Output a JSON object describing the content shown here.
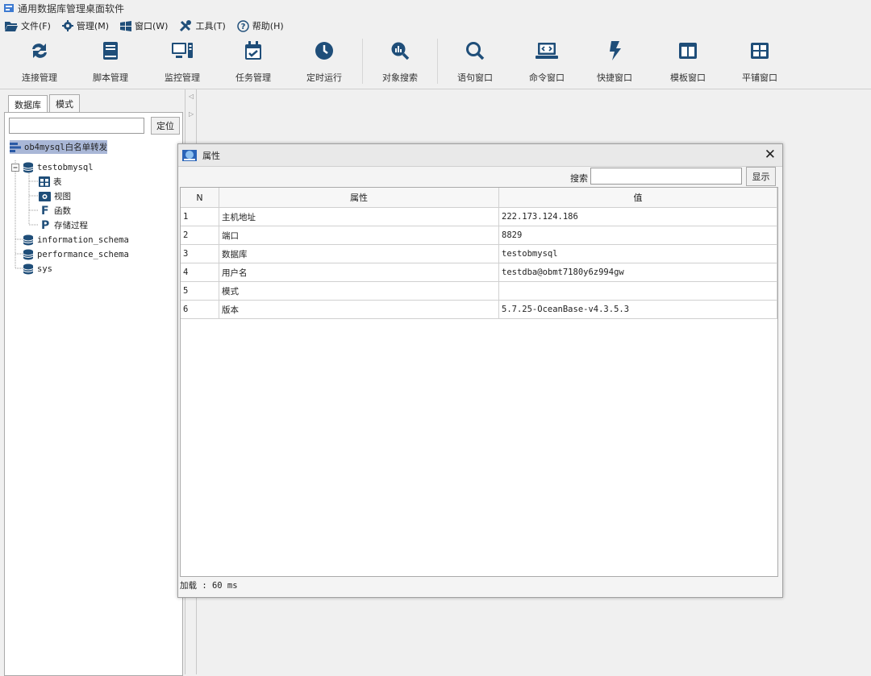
{
  "app": {
    "title": "通用数据库管理桌面软件"
  },
  "menu": [
    {
      "label": "文件(F)",
      "icon": "folder-open-icon"
    },
    {
      "label": "管理(M)",
      "icon": "gear-icon"
    },
    {
      "label": "窗口(W)",
      "icon": "windows-icon"
    },
    {
      "label": "工具(T)",
      "icon": "tools-icon"
    },
    {
      "label": "帮助(H)",
      "icon": "help-icon"
    }
  ],
  "toolbar": [
    {
      "label": "连接管理",
      "icon": "sync-arrows-icon"
    },
    {
      "label": "脚本管理",
      "icon": "book-icon"
    },
    {
      "label": "监控管理",
      "icon": "monitor-icon"
    },
    {
      "label": "任务管理",
      "icon": "calendar-check-icon"
    },
    {
      "label": "定时运行",
      "icon": "clock-icon"
    },
    {
      "label": "对象搜索",
      "icon": "search-chart-icon"
    },
    {
      "label": "语句窗口",
      "icon": "search-icon"
    },
    {
      "label": "命令窗口",
      "icon": "laptop-code-icon"
    },
    {
      "label": "快捷窗口",
      "icon": "bolt-icon"
    },
    {
      "label": "模板窗口",
      "icon": "columns-icon"
    },
    {
      "label": "平铺窗口",
      "icon": "grid-icon"
    }
  ],
  "left_panel": {
    "tabs": [
      "数据库",
      "模式"
    ],
    "locate_button": "定位",
    "tree": {
      "root": "ob4mysql白名单转发",
      "db_open": "testobmysql",
      "children": [
        "表",
        "视图",
        "函数",
        "存储过程"
      ],
      "other_dbs": [
        "information_schema",
        "performance_schema",
        "sys"
      ]
    }
  },
  "dialog": {
    "title": "属性",
    "close": "✕",
    "search_label": "搜索",
    "show_button": "显示",
    "columns": [
      "N",
      "属性",
      "值"
    ],
    "rows": [
      {
        "n": "1",
        "attr": "主机地址",
        "value": "222.173.124.186"
      },
      {
        "n": "2",
        "attr": "端口",
        "value": "8829"
      },
      {
        "n": "3",
        "attr": "数据库",
        "value": "testobmysql"
      },
      {
        "n": "4",
        "attr": "用户名",
        "value": "testdba@obmt7180y6z994gw"
      },
      {
        "n": "5",
        "attr": "模式",
        "value": ""
      },
      {
        "n": "6",
        "attr": "版本",
        "value": "5.7.25-OceanBase-v4.3.5.3"
      }
    ],
    "status": "加载 : 60 ms"
  }
}
